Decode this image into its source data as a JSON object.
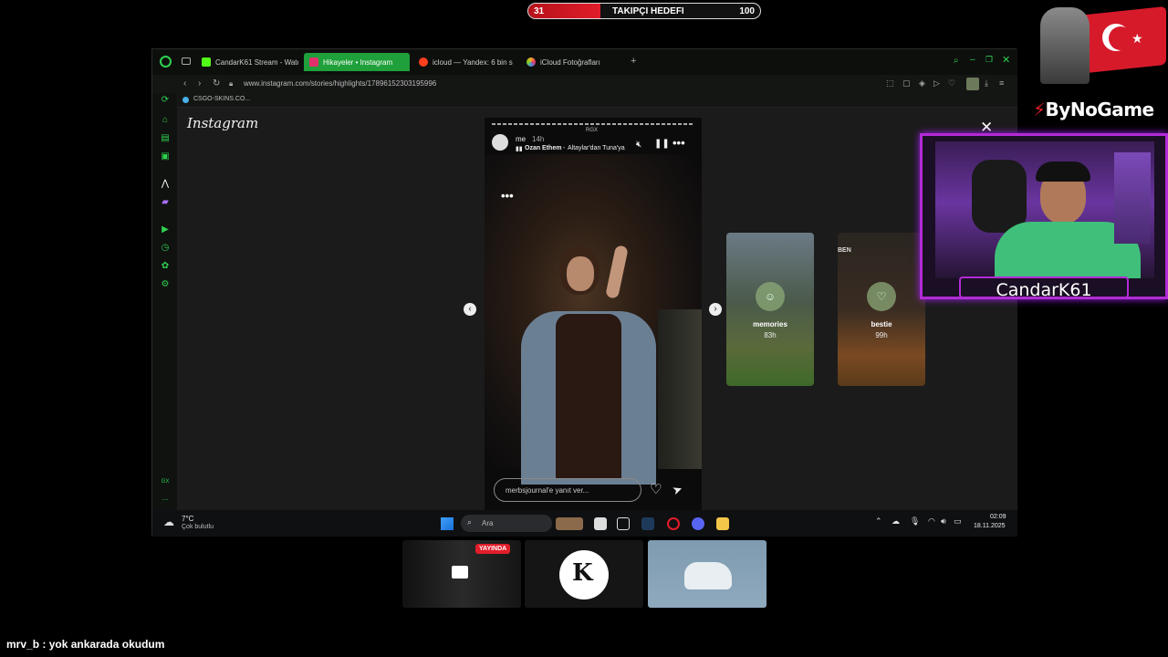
{
  "goal": {
    "current": "31",
    "label": "TAKIPÇI HEDEFI",
    "max": "100",
    "progress_fraction": 0.31,
    "accent": "#e11d2a"
  },
  "browser": {
    "tabs": [
      {
        "label": "CandarK61 Stream - Watc",
        "icon": "kick-icon",
        "color": "#53fc18"
      },
      {
        "label": "Hikayeler • Instagram",
        "icon": "instagram-icon",
        "color": "#e1306c",
        "active": true
      },
      {
        "label": "icloud — Yandex: 6 bin s",
        "icon": "yandex-icon",
        "color": "#fc3f1d"
      },
      {
        "label": "iCloud Fotoğrafları",
        "icon": "icloud-icon",
        "color": "#f5a623"
      }
    ],
    "new_tab": "+",
    "url": "www.instagram.com/stories/highlights/17896152303195996",
    "bookmark": "CSGO-SKINS.CO...",
    "sidebar_gx": "GX",
    "sidebar_more": "..."
  },
  "instagram": {
    "logo": "Instagram",
    "story": {
      "user": "me",
      "age": "14h",
      "artist": "Ozan Ethem",
      "song": "Altaylar'dan Tuna'ya",
      "badge": "RGX",
      "reply_placeholder": "merbsjournal'e yanıt ver..."
    },
    "highlights": [
      {
        "name": "memories",
        "age": "83h",
        "icon": "☺"
      },
      {
        "name": "bestie",
        "age": "99h",
        "icon": "♡"
      }
    ],
    "bestie_overlay": "BEN"
  },
  "taskbar": {
    "weather_temp": "7°C",
    "weather_desc": "Çok bulutlu",
    "search": "Ara",
    "time": "02:09",
    "date": "18.11.2025"
  },
  "webcam": {
    "name": "CandarK61",
    "frame_color": "#b22bd6"
  },
  "sponsor": "ByNoGame",
  "live_badge": "YAYINDA",
  "chat": {
    "user": "mrv_b",
    "message": " : yok ankarada okudum"
  }
}
